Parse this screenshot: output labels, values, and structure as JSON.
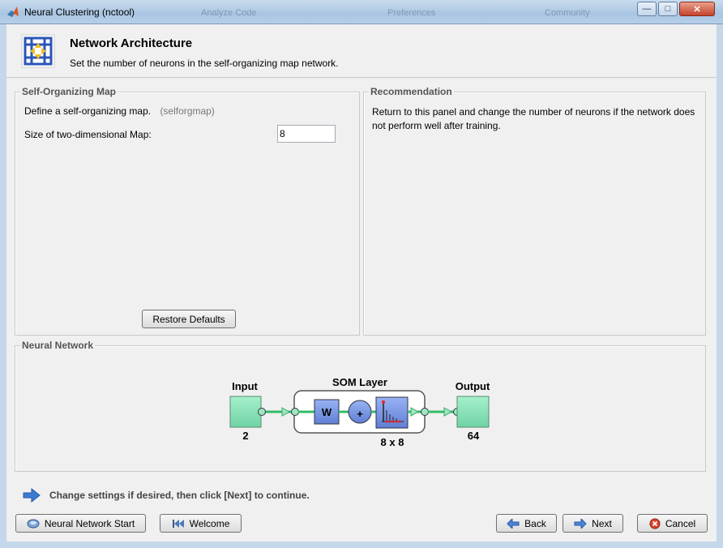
{
  "window": {
    "title": "Neural Clustering (nctool)",
    "ghost_items": [
      "Analyze Code",
      "Preferences",
      "Community"
    ],
    "controls": {
      "minimize": "—",
      "maximize": "□",
      "close": "✕"
    }
  },
  "header": {
    "title": "Network Architecture",
    "subtitle": "Set the number of neurons in the self-organizing map network."
  },
  "som_panel": {
    "legend": "Self-Organizing Map",
    "define_label": "Define a self-organizing map.",
    "define_function": "(selforgmap)",
    "size_label": "Size of two-dimensional Map:",
    "size_value": "8",
    "restore_button": "Restore Defaults"
  },
  "recommendation": {
    "legend": "Recommendation",
    "text": "Return to this panel and change the number of neurons if the network does not perform well after training."
  },
  "network": {
    "legend": "Neural Network",
    "input_label": "Input",
    "input_size": "2",
    "layer_label": "SOM Layer",
    "layer_size": "8 x 8",
    "weight_symbol": "W",
    "sum_symbol": "+",
    "output_label": "Output",
    "output_size": "64"
  },
  "hint": {
    "text": "Change settings  if desired, then click [Next] to continue."
  },
  "footer": {
    "start_button": "Neural Network Start",
    "welcome_button": "Welcome",
    "back_button": "Back",
    "next_button": "Next",
    "cancel_button": "Cancel"
  },
  "colors": {
    "accent_blue": "#3d7bd0",
    "node_green": "#8ee0b8",
    "layer_blue": "#6f8fe0"
  }
}
